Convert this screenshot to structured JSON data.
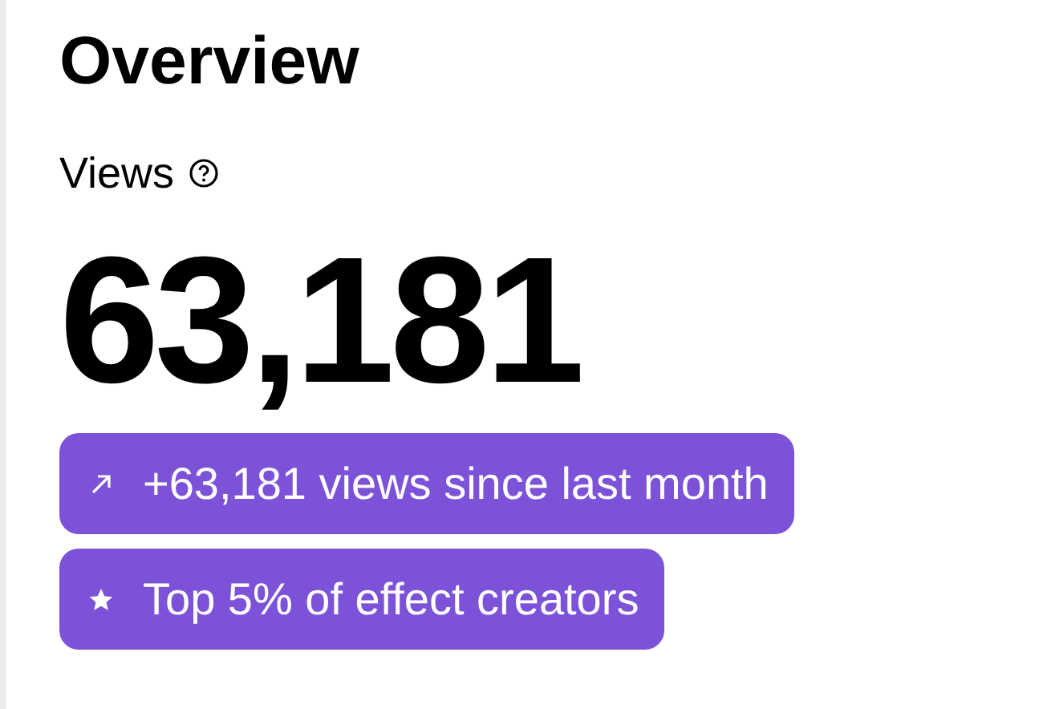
{
  "title": "Overview",
  "metric": {
    "label": "Views",
    "value": "63,181"
  },
  "badges": [
    {
      "kind": "trend",
      "text": "+63,181 views since last month"
    },
    {
      "kind": "star",
      "text": "Top 5% of effect creators"
    }
  ]
}
